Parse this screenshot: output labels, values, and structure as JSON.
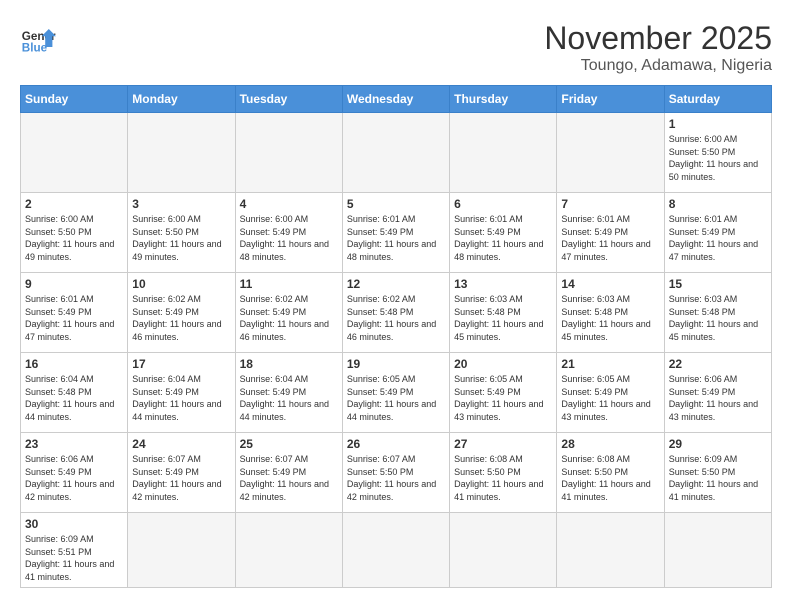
{
  "header": {
    "logo_general": "General",
    "logo_blue": "Blue",
    "month_title": "November 2025",
    "location": "Toungo, Adamawa, Nigeria"
  },
  "weekdays": [
    "Sunday",
    "Monday",
    "Tuesday",
    "Wednesday",
    "Thursday",
    "Friday",
    "Saturday"
  ],
  "days": {
    "d1": {
      "num": "1",
      "sunrise": "6:00 AM",
      "sunset": "5:50 PM",
      "daylight": "11 hours and 50 minutes."
    },
    "d2": {
      "num": "2",
      "sunrise": "6:00 AM",
      "sunset": "5:50 PM",
      "daylight": "11 hours and 49 minutes."
    },
    "d3": {
      "num": "3",
      "sunrise": "6:00 AM",
      "sunset": "5:50 PM",
      "daylight": "11 hours and 49 minutes."
    },
    "d4": {
      "num": "4",
      "sunrise": "6:00 AM",
      "sunset": "5:49 PM",
      "daylight": "11 hours and 48 minutes."
    },
    "d5": {
      "num": "5",
      "sunrise": "6:01 AM",
      "sunset": "5:49 PM",
      "daylight": "11 hours and 48 minutes."
    },
    "d6": {
      "num": "6",
      "sunrise": "6:01 AM",
      "sunset": "5:49 PM",
      "daylight": "11 hours and 48 minutes."
    },
    "d7": {
      "num": "7",
      "sunrise": "6:01 AM",
      "sunset": "5:49 PM",
      "daylight": "11 hours and 47 minutes."
    },
    "d8": {
      "num": "8",
      "sunrise": "6:01 AM",
      "sunset": "5:49 PM",
      "daylight": "11 hours and 47 minutes."
    },
    "d9": {
      "num": "9",
      "sunrise": "6:01 AM",
      "sunset": "5:49 PM",
      "daylight": "11 hours and 47 minutes."
    },
    "d10": {
      "num": "10",
      "sunrise": "6:02 AM",
      "sunset": "5:49 PM",
      "daylight": "11 hours and 46 minutes."
    },
    "d11": {
      "num": "11",
      "sunrise": "6:02 AM",
      "sunset": "5:49 PM",
      "daylight": "11 hours and 46 minutes."
    },
    "d12": {
      "num": "12",
      "sunrise": "6:02 AM",
      "sunset": "5:48 PM",
      "daylight": "11 hours and 46 minutes."
    },
    "d13": {
      "num": "13",
      "sunrise": "6:03 AM",
      "sunset": "5:48 PM",
      "daylight": "11 hours and 45 minutes."
    },
    "d14": {
      "num": "14",
      "sunrise": "6:03 AM",
      "sunset": "5:48 PM",
      "daylight": "11 hours and 45 minutes."
    },
    "d15": {
      "num": "15",
      "sunrise": "6:03 AM",
      "sunset": "5:48 PM",
      "daylight": "11 hours and 45 minutes."
    },
    "d16": {
      "num": "16",
      "sunrise": "6:04 AM",
      "sunset": "5:48 PM",
      "daylight": "11 hours and 44 minutes."
    },
    "d17": {
      "num": "17",
      "sunrise": "6:04 AM",
      "sunset": "5:49 PM",
      "daylight": "11 hours and 44 minutes."
    },
    "d18": {
      "num": "18",
      "sunrise": "6:04 AM",
      "sunset": "5:49 PM",
      "daylight": "11 hours and 44 minutes."
    },
    "d19": {
      "num": "19",
      "sunrise": "6:05 AM",
      "sunset": "5:49 PM",
      "daylight": "11 hours and 44 minutes."
    },
    "d20": {
      "num": "20",
      "sunrise": "6:05 AM",
      "sunset": "5:49 PM",
      "daylight": "11 hours and 43 minutes."
    },
    "d21": {
      "num": "21",
      "sunrise": "6:05 AM",
      "sunset": "5:49 PM",
      "daylight": "11 hours and 43 minutes."
    },
    "d22": {
      "num": "22",
      "sunrise": "6:06 AM",
      "sunset": "5:49 PM",
      "daylight": "11 hours and 43 minutes."
    },
    "d23": {
      "num": "23",
      "sunrise": "6:06 AM",
      "sunset": "5:49 PM",
      "daylight": "11 hours and 42 minutes."
    },
    "d24": {
      "num": "24",
      "sunrise": "6:07 AM",
      "sunset": "5:49 PM",
      "daylight": "11 hours and 42 minutes."
    },
    "d25": {
      "num": "25",
      "sunrise": "6:07 AM",
      "sunset": "5:49 PM",
      "daylight": "11 hours and 42 minutes."
    },
    "d26": {
      "num": "26",
      "sunrise": "6:07 AM",
      "sunset": "5:50 PM",
      "daylight": "11 hours and 42 minutes."
    },
    "d27": {
      "num": "27",
      "sunrise": "6:08 AM",
      "sunset": "5:50 PM",
      "daylight": "11 hours and 41 minutes."
    },
    "d28": {
      "num": "28",
      "sunrise": "6:08 AM",
      "sunset": "5:50 PM",
      "daylight": "11 hours and 41 minutes."
    },
    "d29": {
      "num": "29",
      "sunrise": "6:09 AM",
      "sunset": "5:50 PM",
      "daylight": "11 hours and 41 minutes."
    },
    "d30": {
      "num": "30",
      "sunrise": "6:09 AM",
      "sunset": "5:51 PM",
      "daylight": "11 hours and 41 minutes."
    }
  },
  "labels": {
    "sunrise": "Sunrise:",
    "sunset": "Sunset:",
    "daylight": "Daylight:"
  }
}
